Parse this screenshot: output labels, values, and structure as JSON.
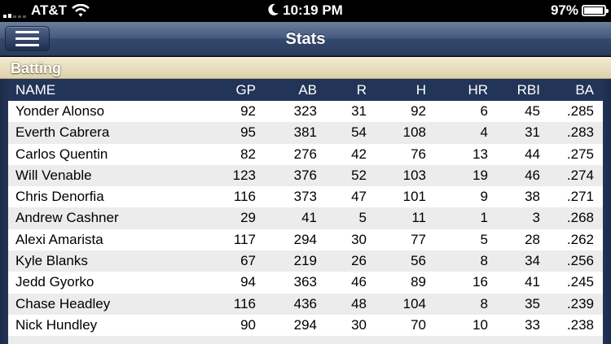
{
  "status_bar": {
    "carrier": "AT&T",
    "time": "10:19 PM",
    "battery": "97%",
    "battery_level": 0.97
  },
  "nav": {
    "title": "Stats"
  },
  "section": {
    "title": "Batting"
  },
  "table": {
    "columns": [
      "NAME",
      "GP",
      "AB",
      "R",
      "H",
      "HR",
      "RBI",
      "BA"
    ],
    "rows": [
      {
        "name": "Yonder Alonso",
        "gp": "92",
        "ab": "323",
        "r": "31",
        "h": "92",
        "hr": "6",
        "rbi": "45",
        "ba": ".285"
      },
      {
        "name": "Everth Cabrera",
        "gp": "95",
        "ab": "381",
        "r": "54",
        "h": "108",
        "hr": "4",
        "rbi": "31",
        "ba": ".283"
      },
      {
        "name": "Carlos Quentin",
        "gp": "82",
        "ab": "276",
        "r": "42",
        "h": "76",
        "hr": "13",
        "rbi": "44",
        "ba": ".275"
      },
      {
        "name": "Will Venable",
        "gp": "123",
        "ab": "376",
        "r": "52",
        "h": "103",
        "hr": "19",
        "rbi": "46",
        "ba": ".274"
      },
      {
        "name": "Chris Denorfia",
        "gp": "116",
        "ab": "373",
        "r": "47",
        "h": "101",
        "hr": "9",
        "rbi": "38",
        "ba": ".271"
      },
      {
        "name": "Andrew Cashner",
        "gp": "29",
        "ab": "41",
        "r": "5",
        "h": "11",
        "hr": "1",
        "rbi": "3",
        "ba": ".268"
      },
      {
        "name": "Alexi Amarista",
        "gp": "117",
        "ab": "294",
        "r": "30",
        "h": "77",
        "hr": "5",
        "rbi": "28",
        "ba": ".262"
      },
      {
        "name": "Kyle Blanks",
        "gp": "67",
        "ab": "219",
        "r": "26",
        "h": "56",
        "hr": "8",
        "rbi": "34",
        "ba": ".256"
      },
      {
        "name": "Jedd Gyorko",
        "gp": "94",
        "ab": "363",
        "r": "46",
        "h": "89",
        "hr": "16",
        "rbi": "41",
        "ba": ".245"
      },
      {
        "name": "Chase Headley",
        "gp": "116",
        "ab": "436",
        "r": "48",
        "h": "104",
        "hr": "8",
        "rbi": "35",
        "ba": ".239"
      },
      {
        "name": "Nick Hundley",
        "gp": "90",
        "ab": "294",
        "r": "30",
        "h": "70",
        "hr": "10",
        "rbi": "33",
        "ba": ".238"
      },
      {
        "name": "",
        "gp": "",
        "ab": "",
        "r": "",
        "h": "",
        "hr": "",
        "rbi": "",
        "ba": ""
      }
    ]
  }
}
